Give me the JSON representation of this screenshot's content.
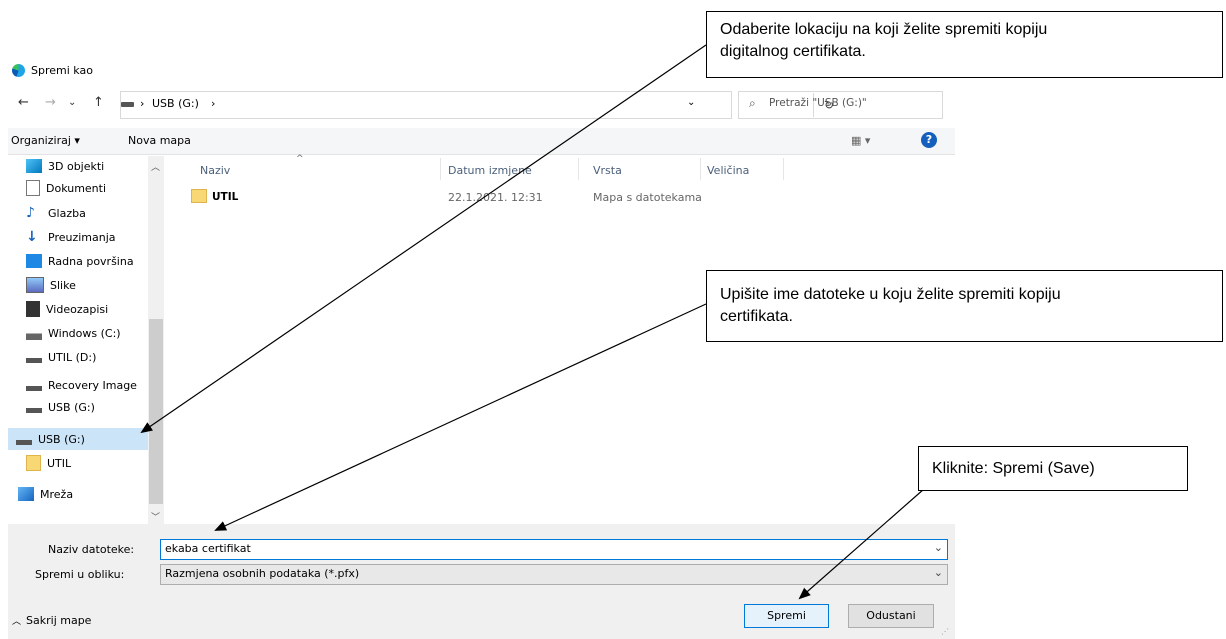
{
  "window": {
    "title": "Spremi kao"
  },
  "nav": {
    "back": "←",
    "forward": "→",
    "recent": "⌄",
    "up": "↑",
    "breadcrumb": [
      "USB (G:)"
    ],
    "refresh": "↻",
    "search_placeholder": "Pretraži \"USB (G:)\""
  },
  "toolbar": {
    "organize": "Organiziraj ▾",
    "new_folder": "Nova mapa",
    "view": "▦ ▾",
    "help": "?"
  },
  "sidebar": {
    "items": [
      {
        "label": "3D objekti",
        "icon": "cube-icon"
      },
      {
        "label": "Dokumenti",
        "icon": "document-icon"
      },
      {
        "label": "Glazba",
        "icon": "music-icon"
      },
      {
        "label": "Preuzimanja",
        "icon": "download-icon"
      },
      {
        "label": "Radna površina",
        "icon": "desktop-icon"
      },
      {
        "label": "Slike",
        "icon": "pictures-icon"
      },
      {
        "label": "Videozapisi",
        "icon": "video-icon"
      },
      {
        "label": "Windows (C:)",
        "icon": "windows-drive-icon"
      },
      {
        "label": "UTIL (D:)",
        "icon": "drive-icon"
      },
      {
        "label": "Recovery Image",
        "icon": "drive-icon"
      },
      {
        "label": "USB (G:)",
        "icon": "drive-icon"
      },
      {
        "label": "USB (G:)",
        "icon": "drive-icon"
      },
      {
        "label": "UTIL",
        "icon": "folder-icon"
      },
      {
        "label": "Mreža",
        "icon": "network-icon"
      }
    ]
  },
  "files": {
    "columns": [
      "Naziv",
      "Datum izmjene",
      "Vrsta",
      "Veličina"
    ],
    "rows": [
      {
        "name": "UTIL",
        "date": "22.1.2021. 12:31",
        "type": "Mapa s datotekama",
        "size": ""
      }
    ]
  },
  "form": {
    "filename_label": "Naziv datoteke:",
    "filename_value": "ekaba certifikat",
    "type_label": "Spremi u obliku:",
    "type_value": "Razmjena osobnih podataka (*.pfx)",
    "hide_folders": "Sakrij mape",
    "save": "Spremi",
    "cancel": "Odustani"
  },
  "callouts": {
    "location": [
      "Odaberite lokaciju na koji želite spremiti kopiju",
      "digitalnog certifikata."
    ],
    "filename": [
      "Upišite ime datoteke u koju želite spremiti kopiju",
      "certifikata."
    ],
    "save": [
      "Kliknite: Spremi (Save)"
    ]
  }
}
